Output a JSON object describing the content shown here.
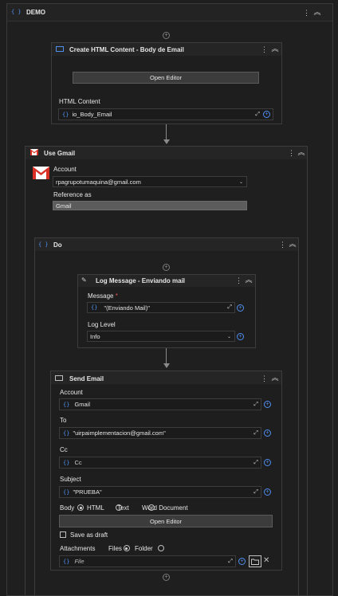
{
  "root": {
    "title": "DEMO"
  },
  "create_html": {
    "title": "Create HTML Content - Body de Email",
    "open_editor": "Open Editor",
    "html_content_label": "HTML Content",
    "html_content_value": "io_Body_Email"
  },
  "use_gmail": {
    "title": "Use Gmail",
    "account_label": "Account",
    "account_value": "rpagrupotumaquina@gmail.com",
    "reference_label": "Reference as",
    "reference_value": "Gmail"
  },
  "do_block": {
    "title": "Do"
  },
  "log_message": {
    "title": "Log Message - Enviando mail",
    "message_label": "Message",
    "required_mark": "*",
    "message_value": "\"(Enviando Mail)\"",
    "log_level_label": "Log Level",
    "log_level_value": "Info"
  },
  "send_email": {
    "title": "Send Email",
    "account_label": "Account",
    "account_value": "Gmail",
    "to_label": "To",
    "to_value": "\"uirpaimplementacion@gmail.com\"",
    "cc_label": "Cc",
    "cc_value": "Cc",
    "subject_label": "Subject",
    "subject_value": "\"PRUEBA\"",
    "body_label": "Body",
    "body_options": [
      "HTML",
      "Text",
      "Word Document"
    ],
    "open_editor": "Open Editor",
    "save_draft_label": "Save as draft",
    "attachments_label": "Attachments",
    "attachment_options": [
      "Files",
      "Folder"
    ],
    "file_placeholder": "File"
  },
  "colors": {
    "accent": "#4f8ff0",
    "gmail_red": "#d93025",
    "background": "#1e1e1e",
    "panel": "#252526"
  }
}
